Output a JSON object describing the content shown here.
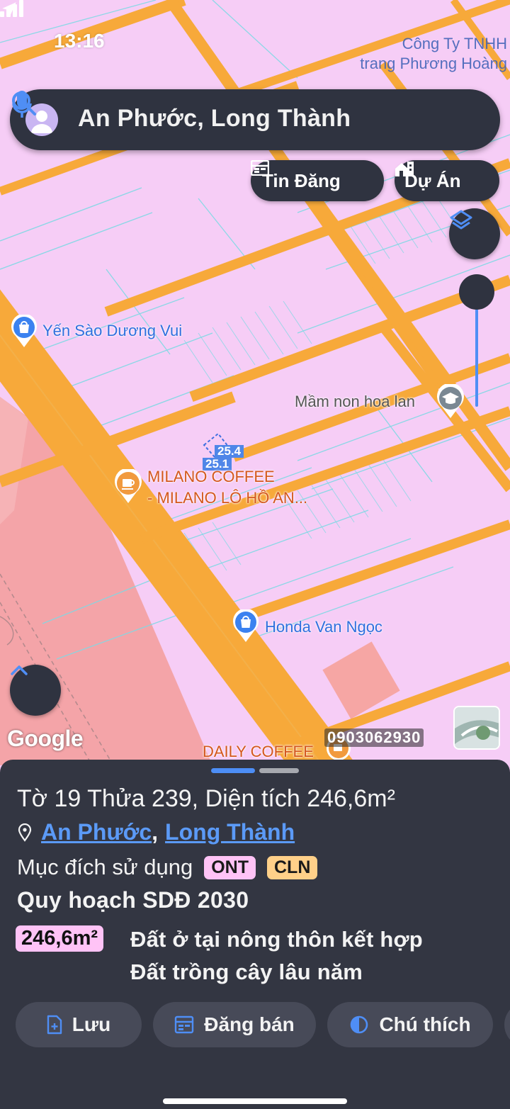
{
  "status": {
    "time": "13:16"
  },
  "map": {
    "company_line1": "Công Ty TNHH",
    "company_line2": "trang Phương Hoàng",
    "google": "Google",
    "phone": "0903062930",
    "plot_label_top": "25.4",
    "plot_label_bottom": "25.1",
    "pois": {
      "yen_sao": "Yến Sào Dương Vui",
      "mam_non": "Mầm non hoa lan",
      "milano_1": "MILANO COFFEE",
      "milano_2": "- MILANO LÔ HỒ AN...",
      "honda": "Honda Van Ngọc",
      "daily": "DAILY COFFEE"
    }
  },
  "search": {
    "query": "An Phước, Long Thành"
  },
  "chips": {
    "tin_dang": "Tin Đăng",
    "du_an": "Dự Án"
  },
  "sheet": {
    "title": "Tờ 19 Thửa 239, Diện tích 246,6m²",
    "ward": "An Phước",
    "separator": ",",
    "district": "Long Thành",
    "purpose_label": "Mục đích sử dụng",
    "tags": [
      "ONT",
      "CLN"
    ],
    "plan_title": "Quy hoạch SDĐ 2030",
    "area_badge": "246,6m²",
    "use_1": "Đất ở tại nông thôn kết hợp",
    "use_2": "Đất trồng cây lâu năm",
    "actions": {
      "save": "Lưu",
      "post": "Đăng bán",
      "legend": "Chú thích"
    }
  },
  "colors": {
    "road": "#f7a93a",
    "land": "#f6cdf6",
    "sheet_bg": "#333642",
    "accent": "#4d8ef6"
  }
}
